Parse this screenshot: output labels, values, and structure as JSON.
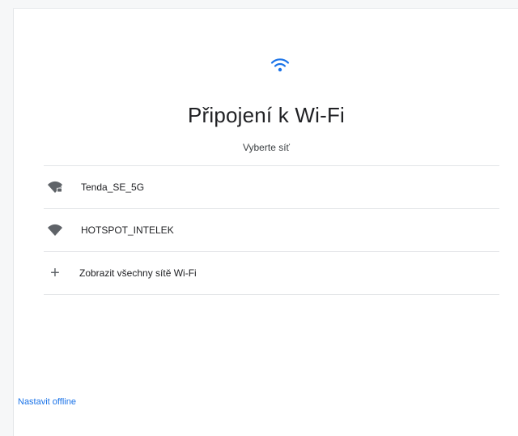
{
  "header": {
    "icon": "wifi-icon",
    "title": "Připojení k Wi-Fi",
    "subtitle": "Vyberte síť"
  },
  "networks": [
    {
      "ssid": "Tenda_SE_5G",
      "icon": "wifi-secured-icon"
    },
    {
      "ssid": "HOTSPOT_INTELEK",
      "icon": "wifi-icon"
    }
  ],
  "show_all": {
    "icon": "plus-icon",
    "label": "Zobrazit všechny sítě Wi-Fi"
  },
  "footer": {
    "offline_link": "Nastavit offline"
  },
  "colors": {
    "accent": "#1a73e8",
    "text": "#202124",
    "divider": "#e2e4e7",
    "icon": "#5f6368"
  }
}
